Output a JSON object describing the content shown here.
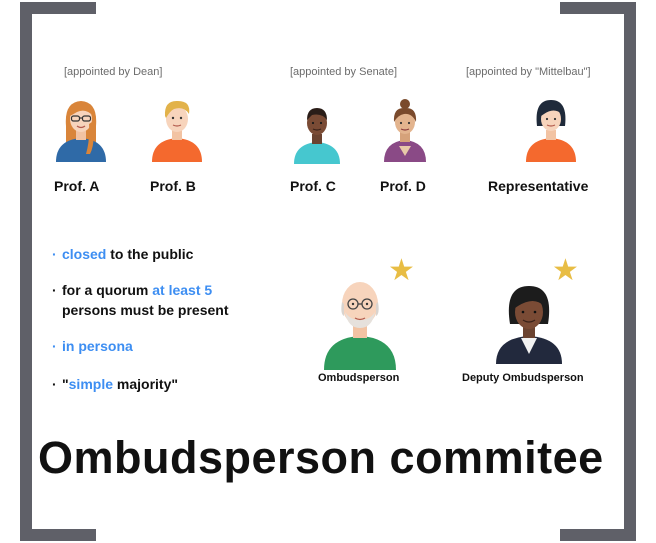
{
  "groups": {
    "dean": "[appointed by Dean]",
    "senate": "[appointed by Senate]",
    "mittelbau": "[appointed by \"Mittelbau\"]"
  },
  "members": [
    "Prof. A",
    "Prof. B",
    "Prof. C",
    "Prof. D",
    "Representative"
  ],
  "bullets": {
    "b1": {
      "hl": "closed",
      "rest": " to the public"
    },
    "b2": {
      "pre": "for a quorum ",
      "hl": "at least 5",
      "line2": "persons must be present"
    },
    "b3": {
      "hl": "in persona"
    },
    "b4": {
      "pre": "\"",
      "hl": "simple",
      "rest": " majority\""
    }
  },
  "roles": {
    "ombud": "Ombudsperson",
    "deputy": "Deputy Ombudsperson"
  },
  "title": "Ombudsperson commitee",
  "colors": {
    "frame": "#5f6068",
    "accent": "#3d8ef2",
    "star": "#e8bd44"
  },
  "icons": [
    "person-avatar-icon",
    "star-icon",
    "bullet-icon"
  ]
}
